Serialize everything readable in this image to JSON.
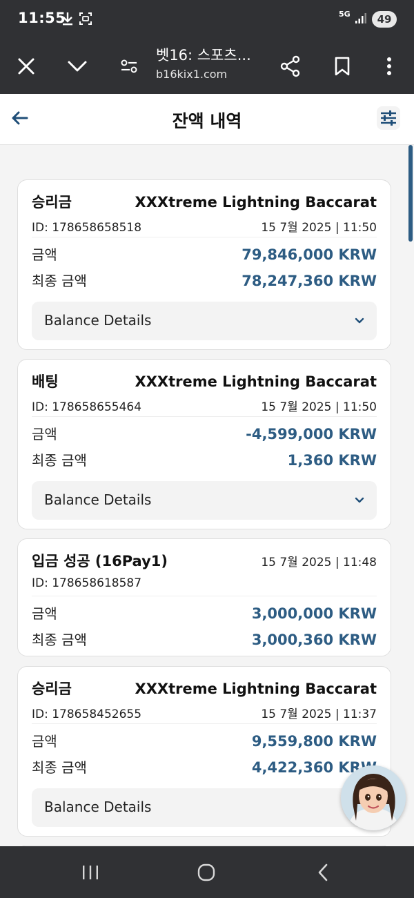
{
  "status_bar": {
    "time": "11:55",
    "network": "5G",
    "battery": "49"
  },
  "browser": {
    "title": "벳16: 스포츠...",
    "url": "b16kix1.com"
  },
  "page": {
    "title": "잔액 내역"
  },
  "labels": {
    "amount": "금액",
    "final_amount": "최종 금액",
    "balance_details": "Balance Details"
  },
  "transactions": [
    {
      "type": "승리금",
      "game": "XXXtreme Lightning Baccarat",
      "id": "ID: 178658658518",
      "datetime": "15 7월 2025 | 11:50",
      "amount": "79,846,000 KRW",
      "final_amount": "78,247,360 KRW"
    },
    {
      "type": "배팅",
      "game": "XXXtreme Lightning Baccarat",
      "id": "ID: 178658655464",
      "datetime": "15 7월 2025 | 11:50",
      "amount": "-4,599,000 KRW",
      "final_amount": "1,360 KRW"
    },
    {
      "type": "입금 성공 (16Pay1)",
      "game": "",
      "id": "ID: 178658618587",
      "datetime": "15 7월 2025 | 11:48",
      "amount": "3,000,000 KRW",
      "final_amount": "3,000,360 KRW"
    },
    {
      "type": "승리금",
      "game": "XXXtreme Lightning Baccarat",
      "id": "ID: 178658452655",
      "datetime": "15 7월 2025 | 11:37",
      "amount": "9,559,800 KRW",
      "final_amount": "4,422,360 KRW"
    }
  ],
  "icons": {
    "status": [
      "download-icon",
      "screenshot-icon",
      "signal-icon"
    ],
    "browser": [
      "close-icon",
      "chevron-down-icon",
      "page-settings-icon",
      "share-icon",
      "bookmark-icon",
      "more-icon"
    ],
    "header": [
      "back-arrow-icon",
      "filter-icon"
    ],
    "nav": [
      "recent-apps-icon",
      "home-icon",
      "back-icon"
    ]
  },
  "colors": {
    "amount": "#2d5c83",
    "bars": "#303134",
    "background": "#f4f4f4"
  }
}
